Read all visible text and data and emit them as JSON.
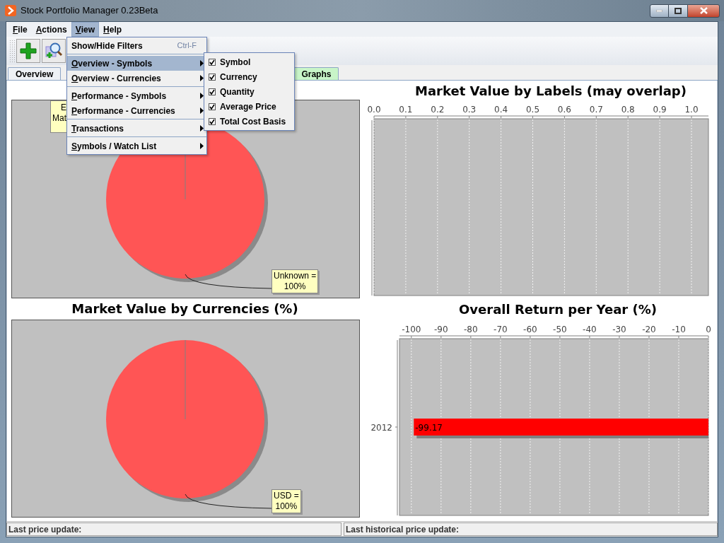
{
  "window": {
    "title": "Stock Portfolio Manager 0.23Beta"
  },
  "menu_bar": [
    {
      "label": "File",
      "selected": false
    },
    {
      "label": "Actions",
      "selected": false
    },
    {
      "label": "View",
      "selected": true
    },
    {
      "label": "Help",
      "selected": false
    }
  ],
  "tabs": [
    {
      "label": "Overview",
      "selected": false
    },
    {
      "label": "Graphs",
      "selected": true
    }
  ],
  "view_menu": [
    {
      "kind": "item",
      "label": "Show/Hide Filters",
      "shortcut": "Ctrl-F",
      "selected": false,
      "separator_before": false
    },
    {
      "kind": "submenu",
      "label": "Overview - Symbols",
      "selected": true,
      "separator_before": true
    },
    {
      "kind": "submenu",
      "label": "Overview - Currencies",
      "selected": false,
      "separator_before": false
    },
    {
      "kind": "submenu",
      "label": "Performance - Symbols",
      "selected": false,
      "separator_before": true
    },
    {
      "kind": "submenu",
      "label": "Performance - Currencies",
      "selected": false,
      "separator_before": false
    },
    {
      "kind": "submenu",
      "label": "Transactions",
      "selected": false,
      "separator_before": true
    },
    {
      "kind": "submenu",
      "label": "Symbols / Watch List",
      "selected": false,
      "separator_before": true
    }
  ],
  "columns_submenu": [
    {
      "label": "Symbol",
      "checked": true
    },
    {
      "label": "Currency",
      "checked": true
    },
    {
      "label": "Quantity",
      "checked": true
    },
    {
      "label": "Average Price",
      "checked": true
    },
    {
      "label": "Total Cost Basis",
      "checked": true
    }
  ],
  "pie_top": {
    "partial_label": "E\nMat",
    "callout": "Unknown =\n100%"
  },
  "labels_chart": {
    "title": "Market Value by Labels (may overlap)",
    "axis_ticks": [
      "0.0",
      "0.1",
      "0.2",
      "0.3",
      "0.4",
      "0.5",
      "0.6",
      "0.7",
      "0.8",
      "0.9",
      "1.0"
    ]
  },
  "pie_bottom": {
    "title": "Market Value by Currencies (%)",
    "callout": "USD =\n100%"
  },
  "return_chart": {
    "title": "Overall Return per Year (%)",
    "chart_data": {
      "type": "bar",
      "orientation": "horizontal",
      "grid": true,
      "categories": [
        "2012"
      ],
      "values": [
        -99.17
      ],
      "data_labels": true,
      "xlim": [
        -104,
        0
      ],
      "xticks": [
        -100,
        -90,
        -80,
        -70,
        -60,
        -50,
        -40,
        -30,
        -20,
        -10,
        0
      ]
    }
  },
  "status_bar": [
    "Last price update:",
    "Last historical price update:"
  ]
}
